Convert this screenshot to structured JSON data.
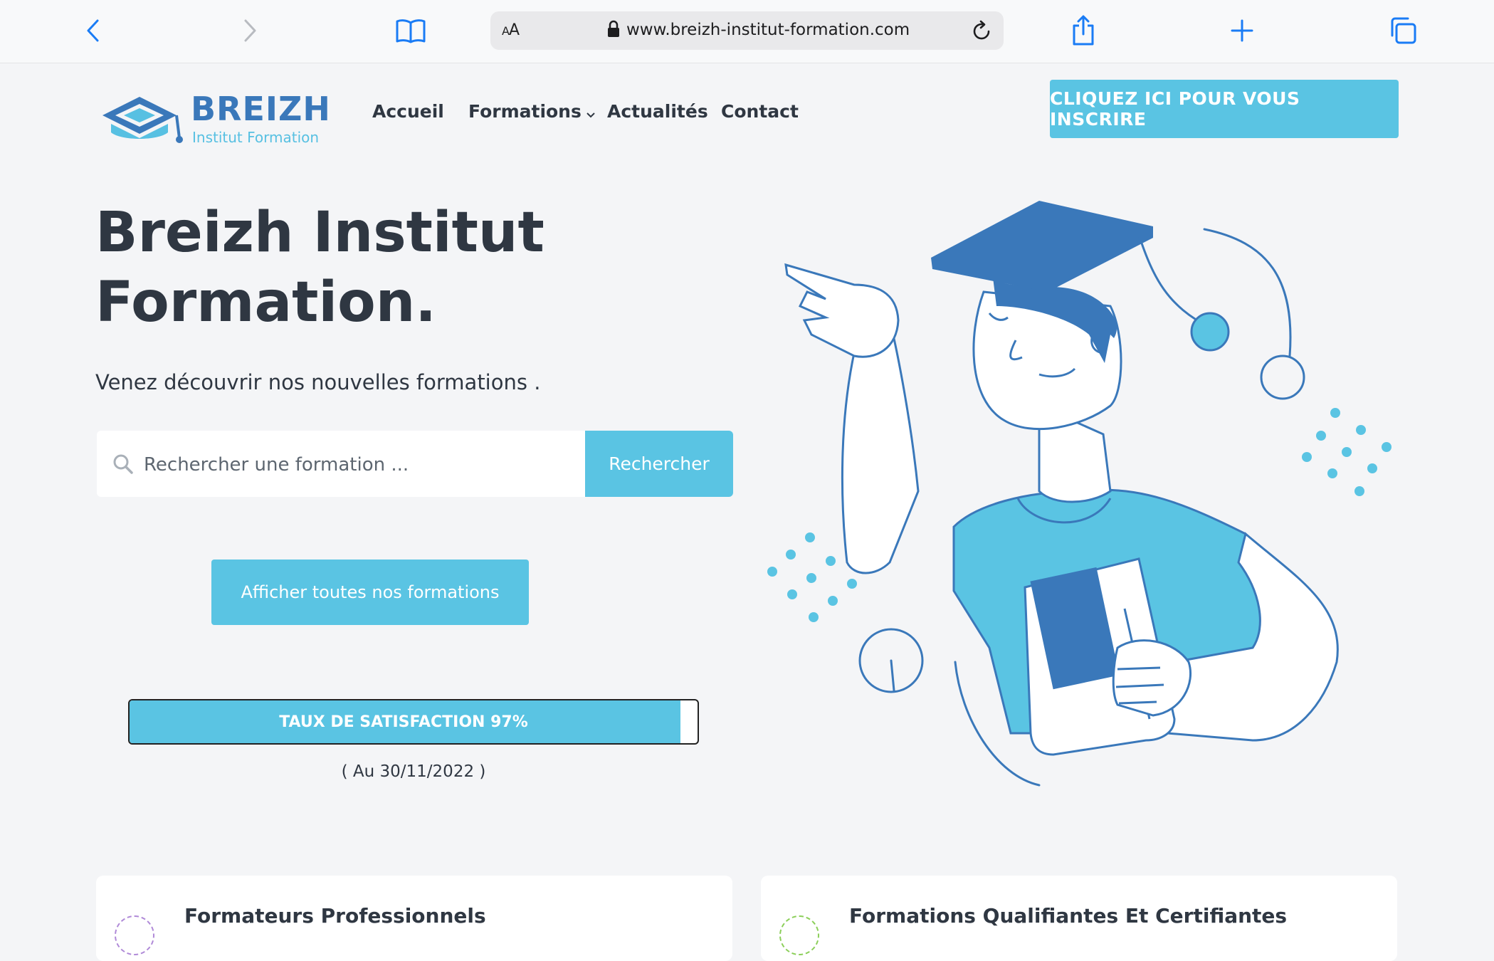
{
  "browser": {
    "url": "www.breizh-institut-formation.com",
    "aa_label_big": "A",
    "aa_label_small": "A",
    "icons": [
      "back-icon",
      "forward-icon",
      "bookmarks-icon",
      "lock-icon",
      "reload-icon",
      "share-icon",
      "new-tab-icon",
      "tabs-icon"
    ]
  },
  "header": {
    "logo_word": "BREIZH",
    "logo_sub": "Institut Formation",
    "nav": [
      {
        "label": "Accueil"
      },
      {
        "label": "Formations"
      },
      {
        "label": "Actualités"
      },
      {
        "label": "Contact"
      }
    ],
    "cta_label": "CLIQUEZ ICI POUR VOUS INSCRIRE"
  },
  "hero": {
    "title_line1": "Breizh Institut",
    "title_line2": "Formation.",
    "subtitle": "Venez découvrir nos nouvelles formations .",
    "search_placeholder": "Rechercher une formation ...",
    "search_button": "Rechercher",
    "all_button": "Afficher toutes nos formations",
    "satisfaction_label": "TAUX DE SATISFACTION 97%",
    "satisfaction_value": 0.97,
    "satisfaction_date": "( Au 30/11/2022 )"
  },
  "cards": [
    {
      "title": "Formateurs Professionnels",
      "icon": "trainer-icon"
    },
    {
      "title": "Formations Qualifiantes Et Certifiantes",
      "icon": "certificate-icon"
    }
  ],
  "colors": {
    "accent": "#5ac4e3",
    "brand_blue": "#3a78ba",
    "text": "#2f3742",
    "background": "#f4f5f7"
  }
}
